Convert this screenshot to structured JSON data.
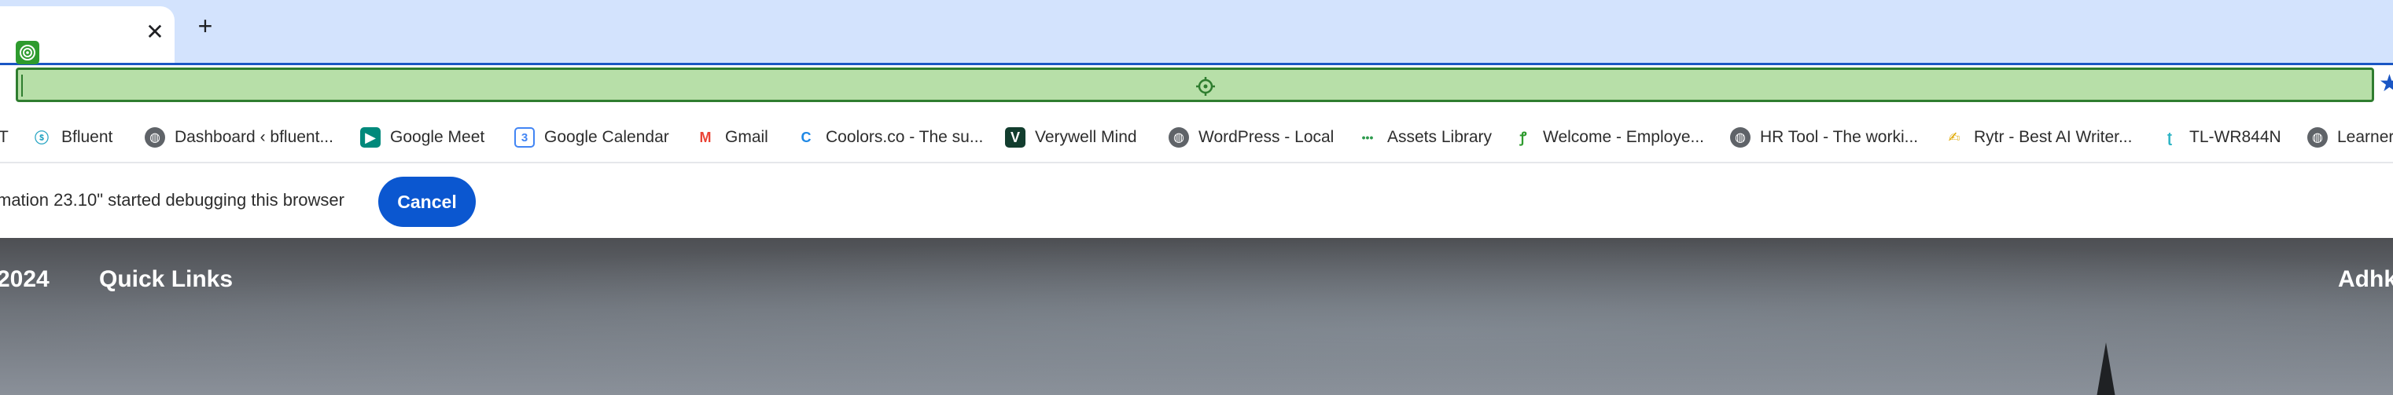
{
  "tabs": {
    "new_tab_symbol": "+",
    "close_symbol": "✕"
  },
  "bookmarks": [
    {
      "label": "T",
      "icon": "cut-text-icon"
    },
    {
      "label": "Bfluent",
      "icon": "bfluent-icon"
    },
    {
      "label": "Dashboard ‹ bfluent...",
      "icon": "globe-icon"
    },
    {
      "label": "Google Meet",
      "icon": "google-meet-icon"
    },
    {
      "label": "Google Calendar",
      "icon": "google-calendar-icon"
    },
    {
      "label": "Gmail",
      "icon": "gmail-icon"
    },
    {
      "label": "Coolors.co - The su...",
      "icon": "coolors-icon"
    },
    {
      "label": "Verywell Mind",
      "icon": "verywell-icon"
    },
    {
      "label": "WordPress - Local",
      "icon": "globe-icon"
    },
    {
      "label": "Assets Library",
      "icon": "assets-icon"
    },
    {
      "label": "Welcome - Employe...",
      "icon": "link-icon"
    },
    {
      "label": "HR Tool - The worki...",
      "icon": "globe-icon"
    },
    {
      "label": "Rytr - Best AI Writer...",
      "icon": "rytr-icon"
    },
    {
      "label": "TL-WR844N",
      "icon": "tplink-icon"
    },
    {
      "label": "Learner",
      "icon": "globe-icon"
    }
  ],
  "infobar": {
    "message": "mation 23.10\" started debugging this browser",
    "cancel_label": "Cancel"
  },
  "page": {
    "nav_year": "2024",
    "nav_quick_links": "Quick Links",
    "nav_right": "Adhk"
  },
  "colors": {
    "tabstrip": "#d3e3fd",
    "omnibox_fill": "#b7dfa8",
    "omnibox_border": "#2f7d2f",
    "cancel_button": "#0b57d0"
  }
}
